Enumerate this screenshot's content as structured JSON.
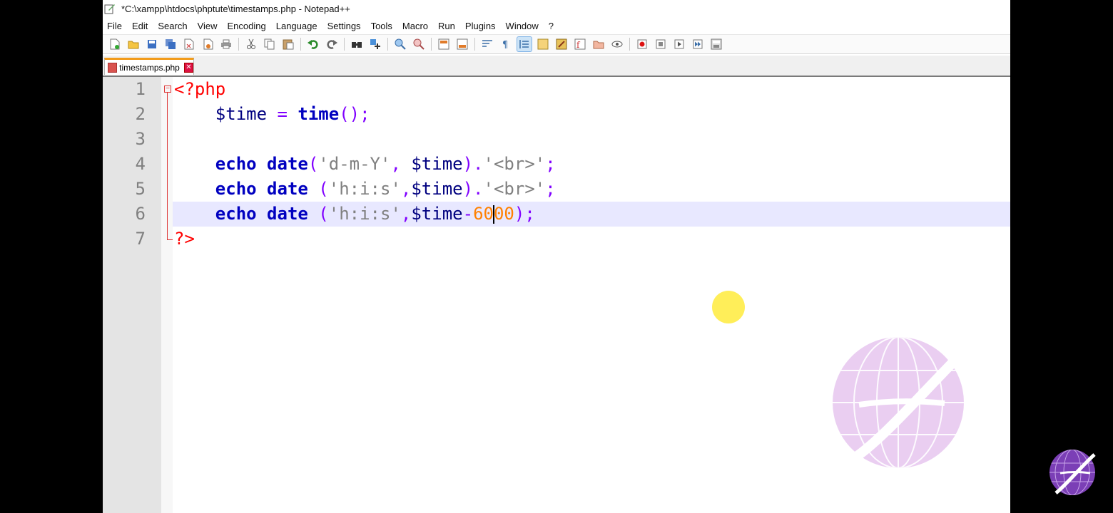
{
  "window": {
    "title": "*C:\\xampp\\htdocs\\phptute\\timestamps.php - Notepad++"
  },
  "menu": [
    "File",
    "Edit",
    "Search",
    "View",
    "Encoding",
    "Language",
    "Settings",
    "Tools",
    "Macro",
    "Run",
    "Plugins",
    "Window",
    "?"
  ],
  "tab": {
    "filename": "timestamps.php"
  },
  "editor": {
    "line_numbers": [
      "1",
      "2",
      "3",
      "4",
      "5",
      "6",
      "7"
    ],
    "current_line": 6
  },
  "code": {
    "l1": {
      "open": "<?php"
    },
    "l2": {
      "var": "$time",
      "assign": " = ",
      "fn": "time",
      "tail": "();"
    },
    "l4": {
      "kw": "echo",
      "fn": "date",
      "p1": "(",
      "s1": "'d-m-Y'",
      "comma": ", ",
      "var": "$time",
      "p2": ").",
      "s2": "'<br>'",
      "semi": ";"
    },
    "l5": {
      "kw": "echo",
      "fn": "date",
      "p1": " (",
      "s1": "'h:i:s'",
      "comma": ",",
      "var": "$time",
      "p2": ").",
      "s2": "'<br>'",
      "semi": ";"
    },
    "l6": {
      "kw": "echo",
      "fn": "date",
      "p1": " (",
      "s1": "'h:i:s'",
      "comma": ",",
      "var": "$time",
      "minus": "-",
      "n1": "60",
      "n2": "00",
      "tail": ");"
    },
    "l7": {
      "close": "?>"
    }
  },
  "icons": {
    "toolbar": [
      "new-file-icon",
      "open-file-icon",
      "save-icon",
      "save-all-icon",
      "close-icon",
      "close-all-icon",
      "print-icon",
      "cut-icon",
      "copy-icon",
      "paste-icon",
      "undo-icon",
      "redo-icon",
      "find-icon",
      "replace-icon",
      "zoom-in-icon",
      "zoom-out-icon",
      "sync-v-icon",
      "sync-h-icon",
      "wrap-icon",
      "all-chars-icon",
      "indent-guide-icon",
      "udl-icon",
      "doc-map-icon",
      "function-list-icon",
      "folder-workspace-icon",
      "monitor-icon",
      "record-macro-icon",
      "stop-macro-icon",
      "play-macro-icon",
      "run-macro-multiple-icon",
      "save-macro-icon"
    ]
  }
}
